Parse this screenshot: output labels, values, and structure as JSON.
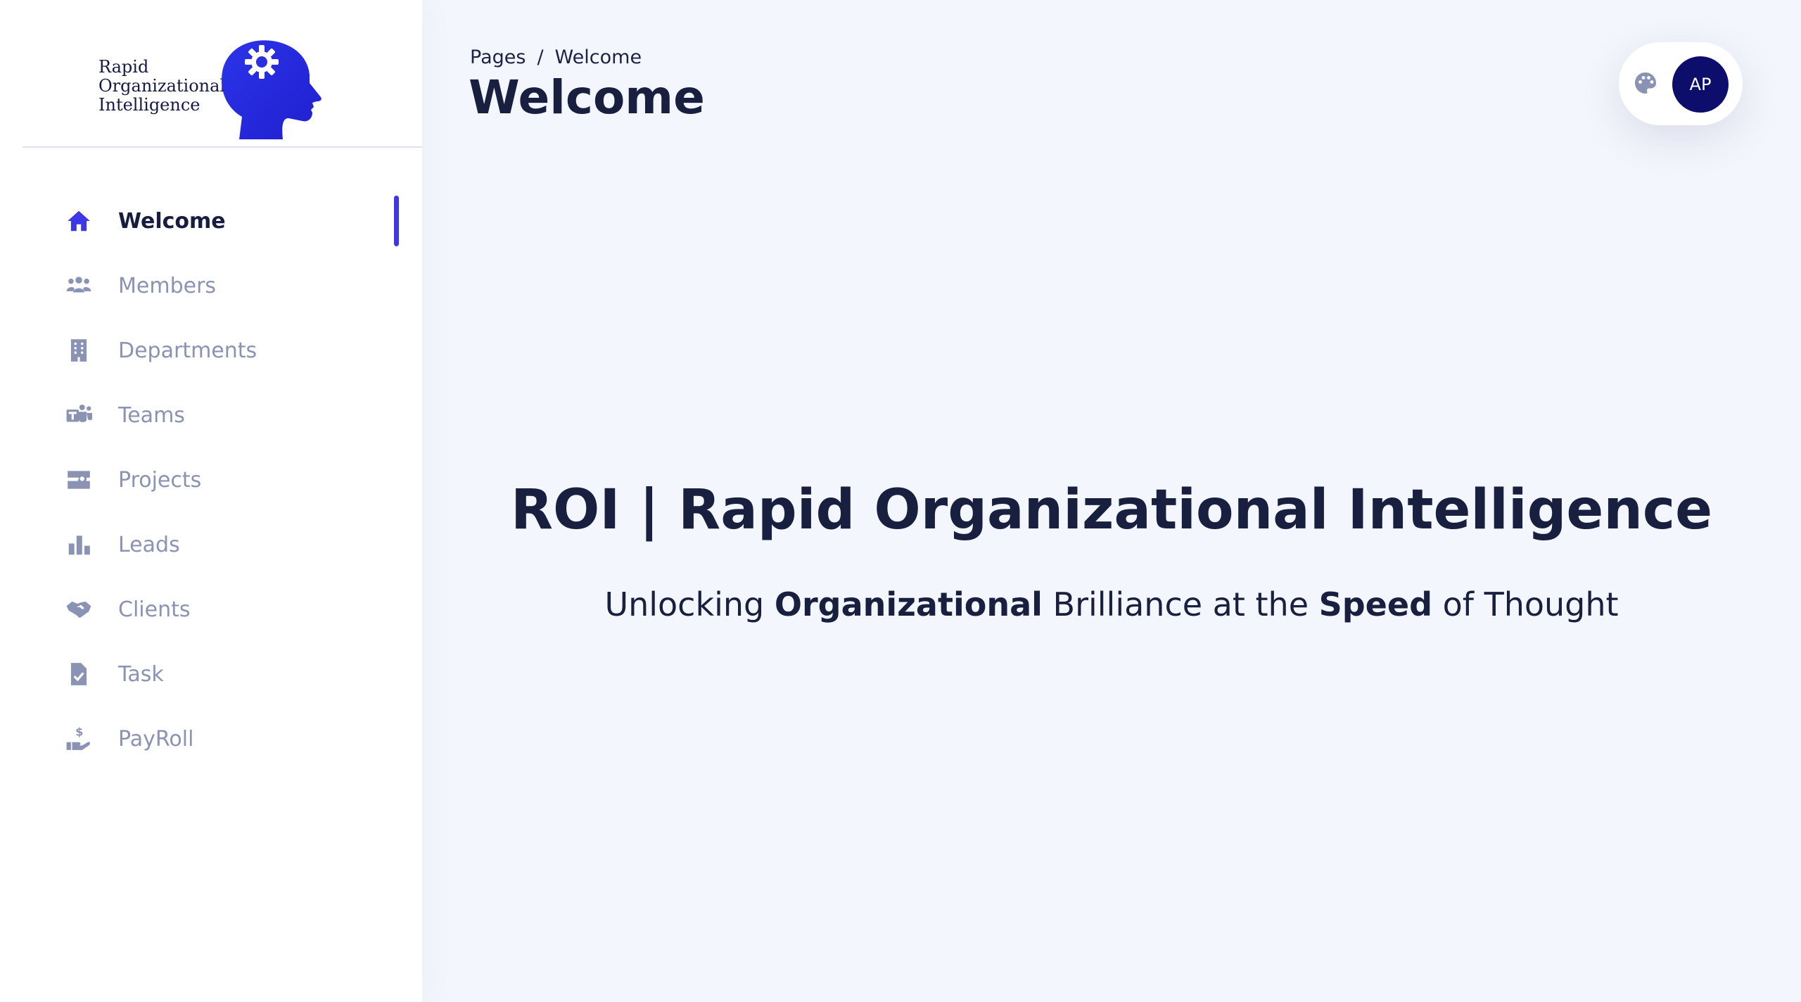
{
  "brand": {
    "logo_lines": [
      "Rapid",
      "Organizational",
      "Intelligence"
    ],
    "logo_color": "#2a2fe0"
  },
  "sidebar": {
    "items": [
      {
        "label": "Welcome",
        "icon": "home-icon",
        "active": true
      },
      {
        "label": "Members",
        "icon": "people-icon",
        "active": false
      },
      {
        "label": "Departments",
        "icon": "building-icon",
        "active": false
      },
      {
        "label": "Teams",
        "icon": "teams-icon",
        "active": false
      },
      {
        "label": "Projects",
        "icon": "projects-icon",
        "active": false
      },
      {
        "label": "Leads",
        "icon": "bar-chart-icon",
        "active": false
      },
      {
        "label": "Clients",
        "icon": "handshake-icon",
        "active": false
      },
      {
        "label": "Task",
        "icon": "task-icon",
        "active": false
      },
      {
        "label": "PayRoll",
        "icon": "payroll-icon",
        "active": false
      }
    ],
    "accent": "#3d37e6",
    "muted_color": "#8b93b5"
  },
  "header": {
    "breadcrumb": {
      "root": "Pages",
      "separator": "/",
      "current": "Welcome"
    },
    "title": "Welcome"
  },
  "user": {
    "initials": "AP",
    "avatar_color": "#0d0e6b",
    "theme_button_icon": "palette-icon"
  },
  "hero": {
    "title": "ROI | Rapid Organizational Intelligence",
    "subtitle_parts": {
      "p1": "Unlocking ",
      "b1": "Organizational",
      "p2": " Brilliance at the ",
      "b2": "Speed",
      "p3": " of Thought"
    }
  }
}
